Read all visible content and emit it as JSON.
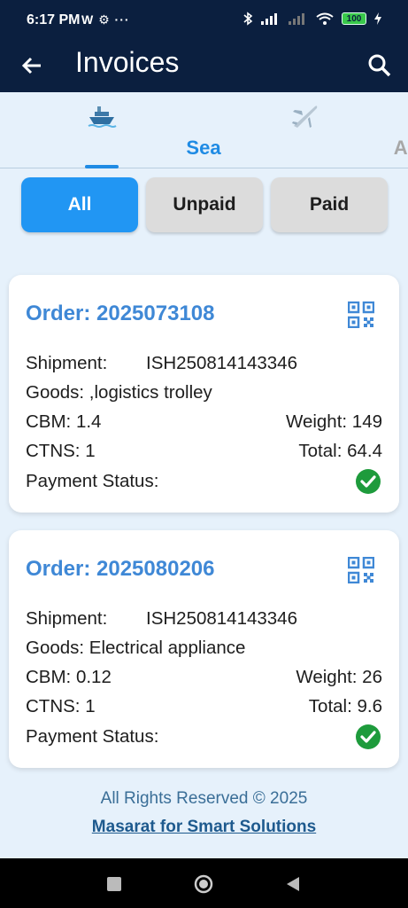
{
  "status_bar": {
    "time": "6:17 PM",
    "notifications": "W ⚙ ··· ",
    "battery": "100"
  },
  "appbar": {
    "title": "Invoices",
    "back_icon": "arrow-back-icon",
    "search_icon": "search-icon"
  },
  "tabs": [
    {
      "label": "Sea",
      "icon": "ship-icon",
      "active": true
    },
    {
      "label": "Air",
      "icon": "airplane-icon",
      "active": false
    }
  ],
  "filters": {
    "all": "All",
    "unpaid": "Unpaid",
    "paid": "Paid",
    "active": "All"
  },
  "invoices": [
    {
      "order": "Order: 2025073108",
      "shipment_label": "Shipment:",
      "shipment_value": "ISH250814143346",
      "goods": "Goods: ,logistics trolley",
      "cbm": "CBM: 1.4",
      "weight": "Weight: 149",
      "ctns": "CTNS: 1",
      "total": "Total: 64.4",
      "payment_label": "Payment Status:",
      "paid": true
    },
    {
      "order": "Order: 2025080206",
      "shipment_label": "Shipment:",
      "shipment_value": "ISH250814143346",
      "goods": "Goods: Electrical appliance",
      "cbm": "CBM: 0.12",
      "weight": "Weight: 26",
      "ctns": "CTNS: 1",
      "total": "Total: 9.6",
      "payment_label": "Payment Status:",
      "paid": true
    }
  ],
  "footer": {
    "copyright": "All Rights Reserved © 2025",
    "company": "Masarat for Smart Solutions"
  },
  "colors": {
    "header_bg": "#0b1f3f",
    "accent": "#2196f3",
    "order_text": "#3f88d6",
    "paid_green": "#1e9b3c"
  }
}
